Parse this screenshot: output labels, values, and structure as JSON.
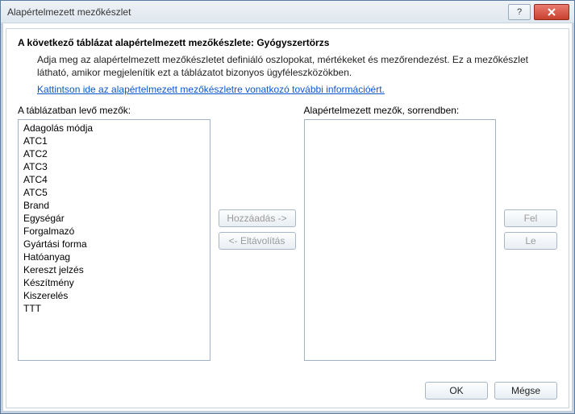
{
  "titlebar": {
    "title": "Alapértelmezett mezőkészlet"
  },
  "heading": "A következő táblázat alapértelmezett mezőkészlete: Gyógyszertörzs",
  "description": "Adja meg az alapértelmezett mezőkészletet definiáló oszlopokat, mértékeket és mezőrendezést. Ez a mezőkészlet látható, amikor megjelenítik ezt a táblázatot bizonyos ügyféleszközökben.",
  "help_link": "Kattintson ide az alapértelmezett mezőkészletre vonatkozó további információért.",
  "left": {
    "label": "A táblázatban levő mezők:",
    "items": [
      "Adagolás módja",
      "ATC1",
      "ATC2",
      "ATC3",
      "ATC4",
      "ATC5",
      "Brand",
      "Egységár",
      "Forgalmazó",
      "Gyártási forma",
      "Hatóanyag",
      "Kereszt jelzés",
      "Készítmény",
      "Kiszerelés",
      "TTT"
    ]
  },
  "right": {
    "label": "Alapértelmezett mezők, sorrendben:",
    "items": []
  },
  "buttons": {
    "add": "Hozzáadás ->",
    "remove": "<- Eltávolítás",
    "up": "Fel",
    "down": "Le",
    "ok": "OK",
    "cancel": "Mégse"
  }
}
